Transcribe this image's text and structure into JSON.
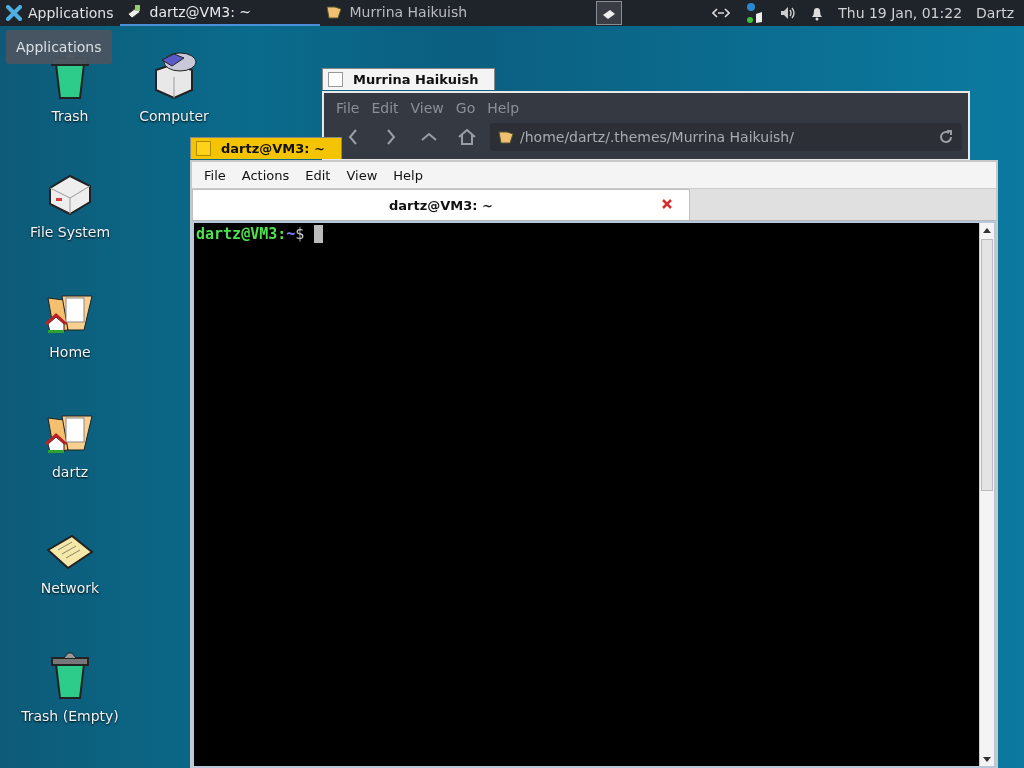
{
  "panel": {
    "apps_button": "Applications",
    "tasks": [
      {
        "title": "dartz@VM3: ~",
        "kind": "terminal",
        "selected": true
      },
      {
        "title": "Murrina Haikuish",
        "kind": "folder",
        "selected": false
      }
    ],
    "clock": "Thu 19 Jan, 01:22",
    "user": "Dartz"
  },
  "tooltip": "Applications",
  "desktop_icons": [
    {
      "label": "Trash",
      "kind": "trash"
    },
    {
      "label": "Computer",
      "kind": "computer"
    },
    {
      "label": "File System",
      "kind": "drive"
    },
    {
      "label": "Home",
      "kind": "home"
    },
    {
      "label": "dartz",
      "kind": "home"
    },
    {
      "label": "Network",
      "kind": "network"
    },
    {
      "label": "Trash (Empty)",
      "kind": "trash"
    }
  ],
  "file_manager": {
    "title": "Murrina Haikuish",
    "focused": false,
    "menu": [
      "File",
      "Edit",
      "View",
      "Go",
      "Help"
    ],
    "path": "/home/dartz/.themes/Murrina Haikuish/"
  },
  "terminal": {
    "title": "dartz@VM3: ~",
    "focused": true,
    "menu": [
      "File",
      "Actions",
      "Edit",
      "View",
      "Help"
    ],
    "tabs": [
      {
        "title": "dartz@VM3: ~",
        "selected": true
      }
    ],
    "prompt": {
      "user_host": "dartz@VM3",
      "separator": ":",
      "path": "~",
      "symbol": "$"
    }
  }
}
